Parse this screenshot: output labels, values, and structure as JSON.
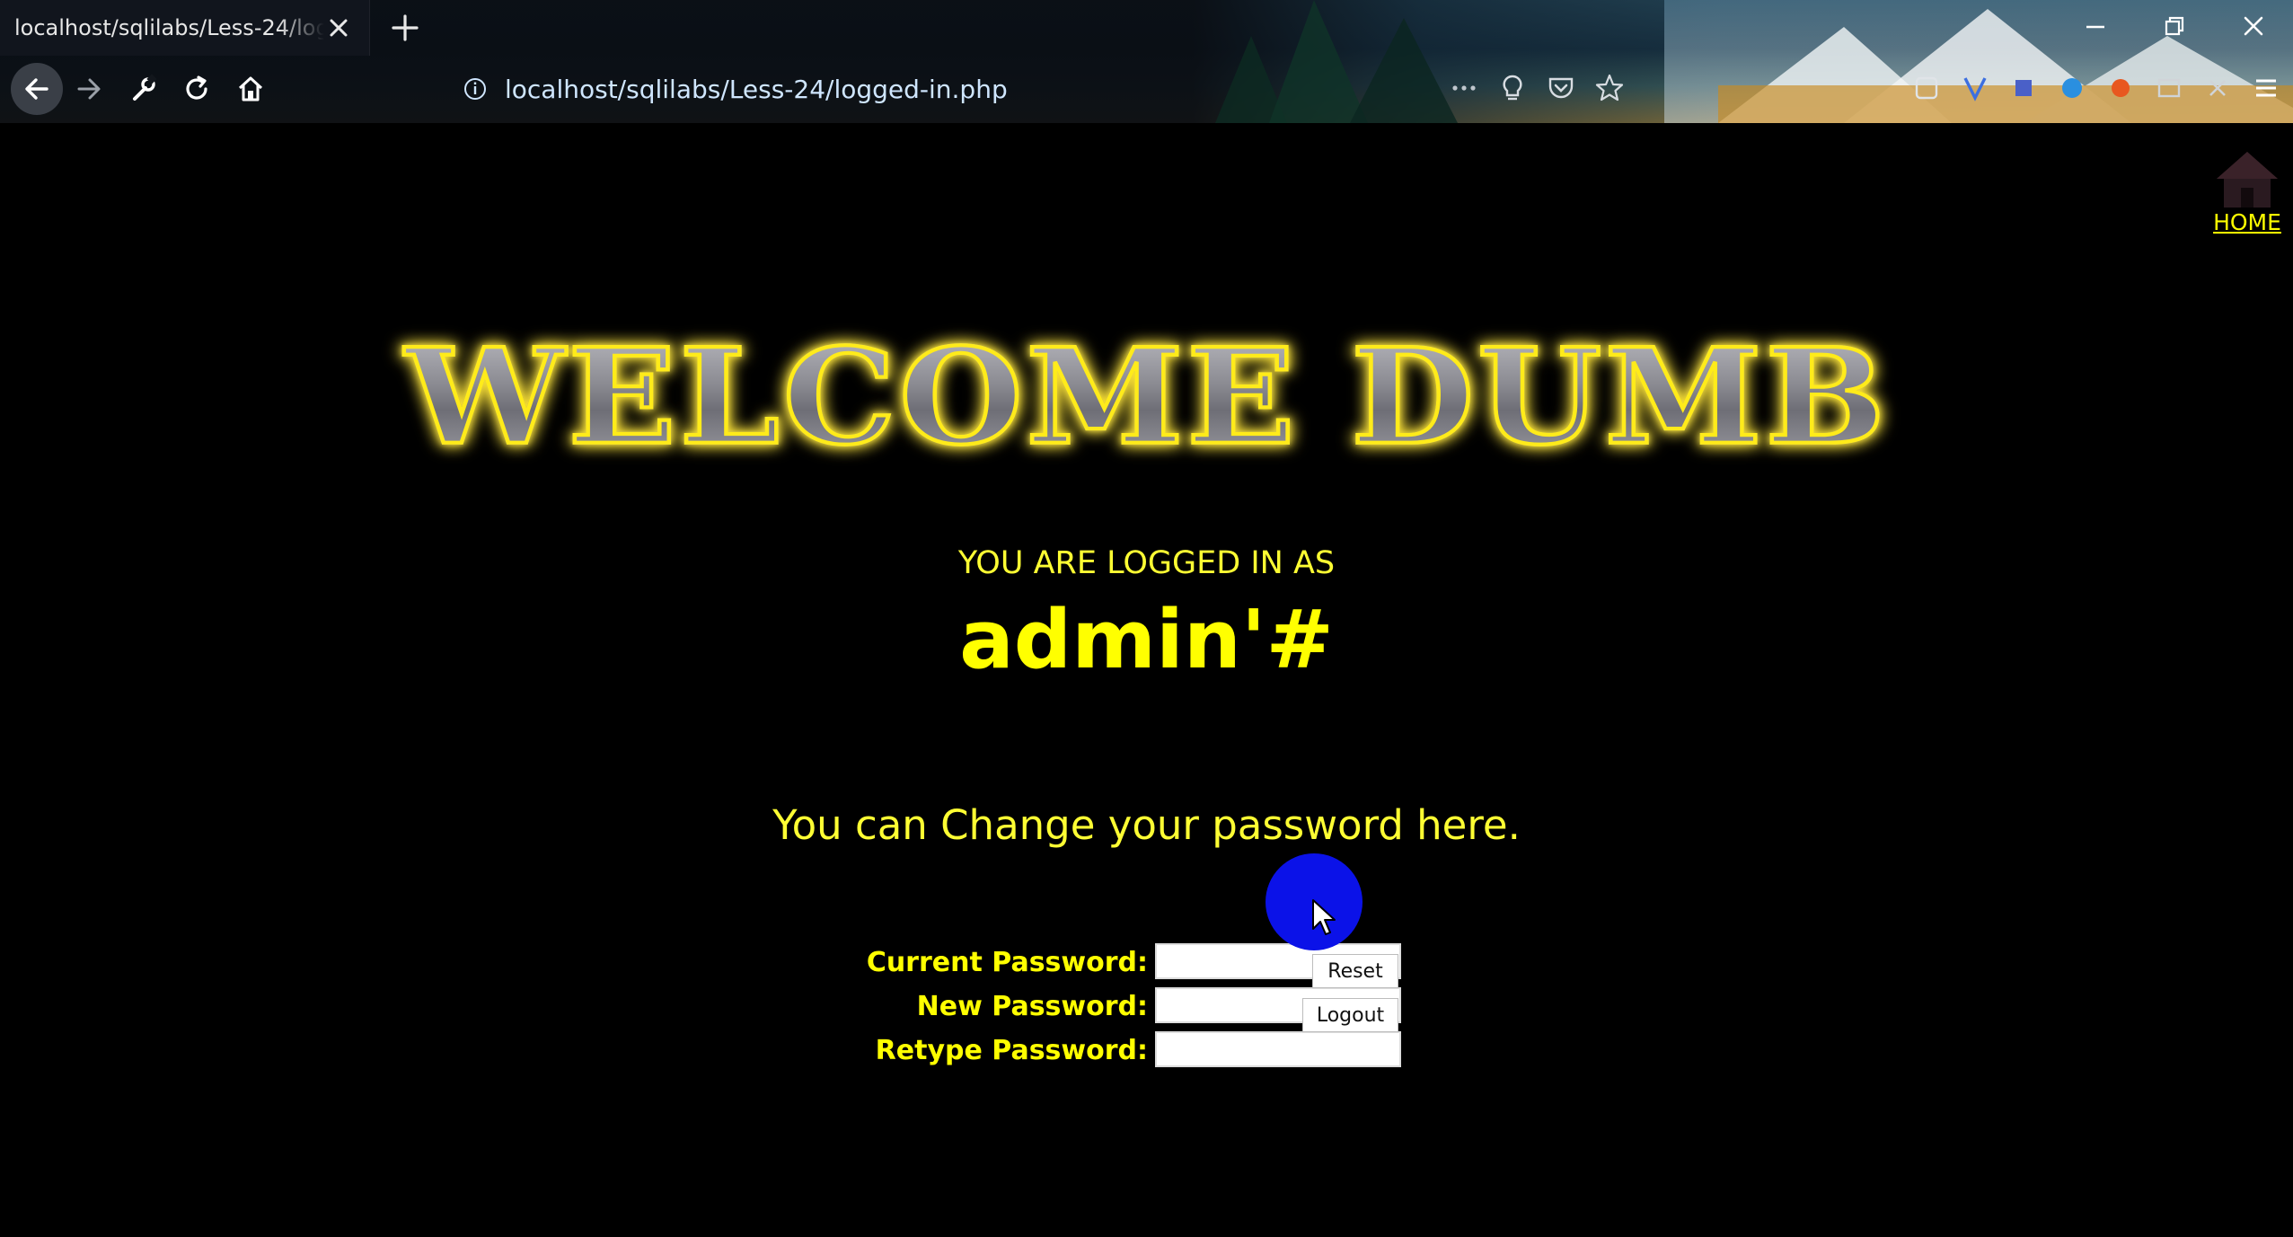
{
  "browser": {
    "tab_title": "localhost/sqlilabs/Less-24/logged-in.php",
    "url": "localhost/sqlilabs/Less-24/logged-in.php"
  },
  "page": {
    "home_label": "HOME",
    "welcome_banner": "WELCOME DUMB",
    "logged_in_label": "YOU ARE LOGGED IN AS",
    "username": "admin'#",
    "change_message": "You can Change your password here.",
    "form": {
      "current_password_label": "Current Password:",
      "new_password_label": "New Password:",
      "retype_password_label": "Retype Password:",
      "current_password_value": "",
      "new_password_value": "",
      "retype_password_value": "",
      "reset_label": "Reset",
      "logout_label": "Logout"
    }
  },
  "colors": {
    "page_background": "#000000",
    "text_yellow": "#ffff00",
    "cursor_highlight": "#0b12e8"
  },
  "icons": {
    "toolbar": [
      "back-arrow-icon",
      "forward-arrow-icon",
      "wrench-icon",
      "reload-icon",
      "home-icon"
    ],
    "url": [
      "info-icon",
      "more-dots-icon",
      "lightbulb-icon",
      "pocket-icon",
      "star-icon"
    ],
    "window": [
      "minimize-icon",
      "restore-icon",
      "close-icon"
    ]
  }
}
